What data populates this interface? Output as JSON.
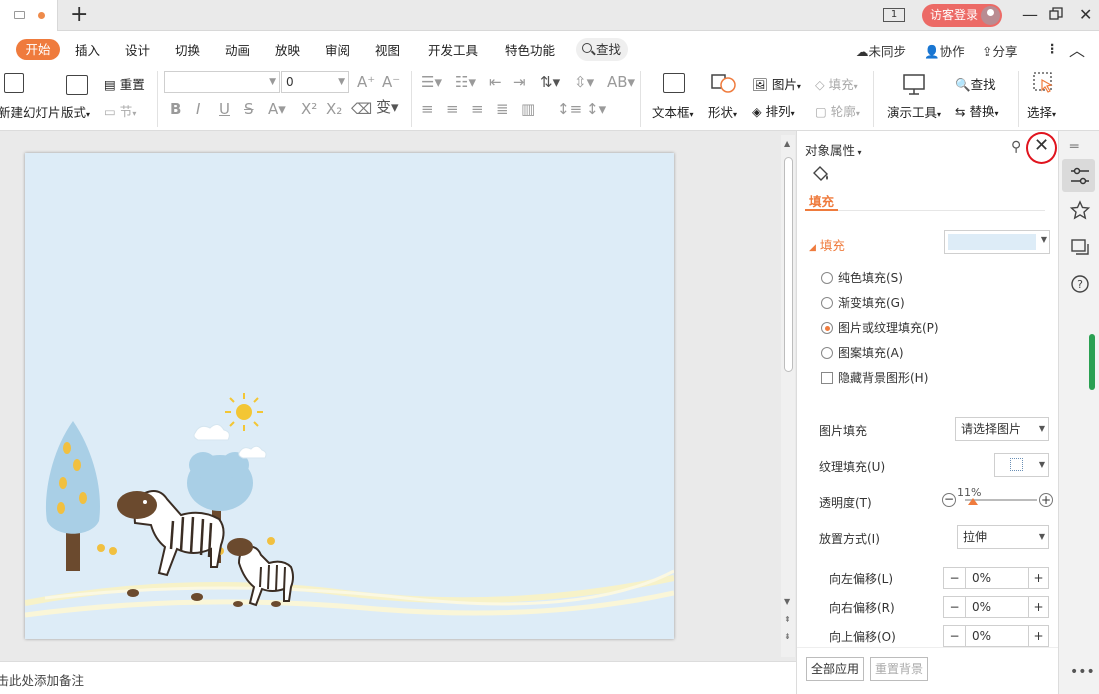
{
  "titlebar": {
    "new_tab": "+",
    "window_indicator": "1",
    "guest_login": "访客登录"
  },
  "menu": {
    "items": [
      "开始",
      "插入",
      "设计",
      "切换",
      "动画",
      "放映",
      "审阅",
      "视图",
      "开发工具",
      "特色功能"
    ],
    "search": "查找",
    "sync": "未同步",
    "collab": "协作",
    "share": "分享"
  },
  "ribbon": {
    "new_slide": "新建幻灯片",
    "layout": "版式",
    "reset": "重置",
    "section": "节",
    "font_name": "",
    "font_size": "0",
    "text_box": "文本框",
    "shape": "形状",
    "picture": "图片",
    "fill": "填充",
    "arrange": "排列",
    "outline": "轮廓",
    "presentation_tools": "演示工具",
    "find": "查找",
    "replace": "替换",
    "select": "选择"
  },
  "notes": {
    "placeholder": "单击此处添加备注"
  },
  "pane": {
    "title": "对象属性",
    "tab_fill": "填充",
    "section_fill": "填充",
    "options": [
      {
        "label": "纯色填充(S)",
        "type": "radio",
        "checked": false
      },
      {
        "label": "渐变填充(G)",
        "type": "radio",
        "checked": false
      },
      {
        "label": "图片或纹理填充(P)",
        "type": "radio",
        "checked": true
      },
      {
        "label": "图案填充(A)",
        "type": "radio",
        "checked": false
      },
      {
        "label": "隐藏背景图形(H)",
        "type": "checkbox",
        "checked": false
      }
    ],
    "picture_fill_label": "图片填充",
    "picture_fill_value": "请选择图片",
    "texture_fill_label": "纹理填充(U)",
    "transparency_label": "透明度(T)",
    "transparency_value": "11%",
    "transparency": 0.11,
    "placement_label": "放置方式(I)",
    "placement_value": "拉伸",
    "offset_left_label": "向左偏移(L)",
    "offset_left_value": "0%",
    "offset_right_label": "向右偏移(R)",
    "offset_right_value": "0%",
    "offset_up_label": "向上偏移(O)",
    "offset_up_value": "0%",
    "apply_all": "全部应用",
    "reset_bg": "重置背景"
  },
  "colors": {
    "accent": "#ef7b3d",
    "slide_bg": "#ddecf7",
    "guest": "#ec6a66",
    "highlight_ring": "#e0141e"
  }
}
